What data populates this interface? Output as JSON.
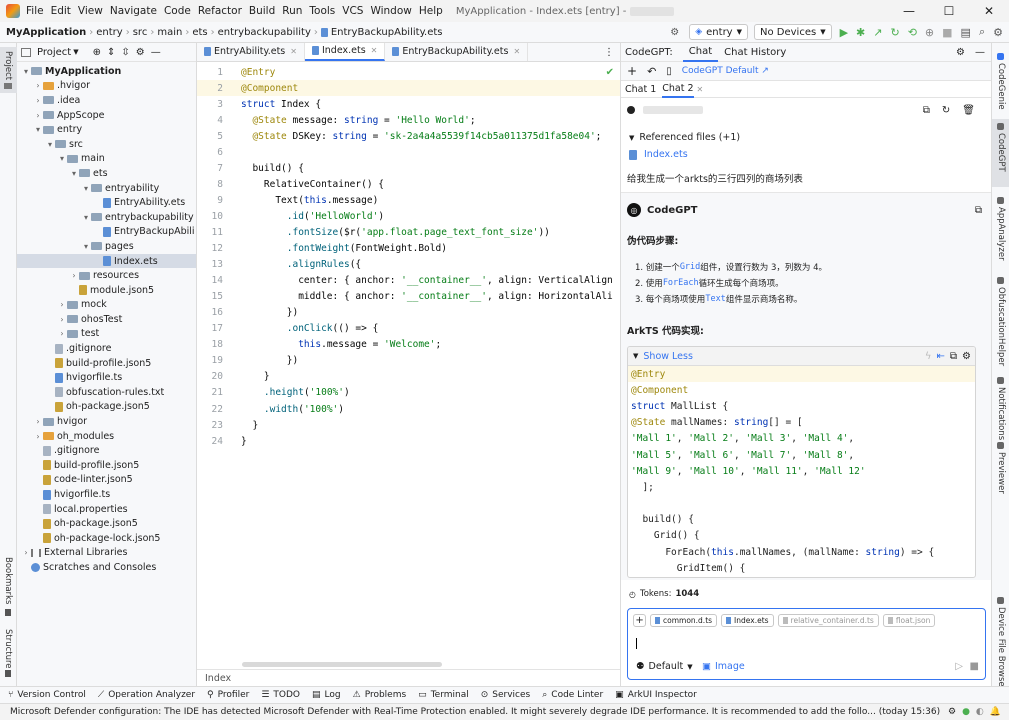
{
  "titlebar": {
    "menu": [
      "File",
      "Edit",
      "View",
      "Navigate",
      "Code",
      "Refactor",
      "Build",
      "Run",
      "Tools",
      "VCS",
      "Window",
      "Help"
    ],
    "title": "MyApplication - Index.ets [entry] -"
  },
  "navbar": {
    "crumbs": [
      "MyApplication",
      "entry",
      "src",
      "main",
      "ets",
      "entrybackupability",
      "EntryBackupAbility.ets"
    ],
    "run_config": "entry",
    "device": "No Devices"
  },
  "left_strip": {
    "project": "Project",
    "bookmarks": "Bookmarks",
    "structure": "Structure"
  },
  "project": {
    "label": "Project",
    "tree": [
      {
        "label": "MyApplication",
        "indent": 0,
        "arrow": "open",
        "icon": "folder"
      },
      {
        "label": ".hvigor",
        "indent": 1,
        "arrow": "closed",
        "icon": "folder-o"
      },
      {
        "label": ".idea",
        "indent": 1,
        "arrow": "closed",
        "icon": "folder"
      },
      {
        "label": "AppScope",
        "indent": 1,
        "arrow": "closed",
        "icon": "folder"
      },
      {
        "label": "entry",
        "indent": 1,
        "arrow": "open",
        "icon": "folder"
      },
      {
        "label": "src",
        "indent": 2,
        "arrow": "open",
        "icon": "folder"
      },
      {
        "label": "main",
        "indent": 3,
        "arrow": "open",
        "icon": "folder"
      },
      {
        "label": "ets",
        "indent": 4,
        "arrow": "open",
        "icon": "folder"
      },
      {
        "label": "entryability",
        "indent": 5,
        "arrow": "open",
        "icon": "folder"
      },
      {
        "label": "EntryAbility.ets",
        "indent": 6,
        "arrow": "",
        "icon": "ts"
      },
      {
        "label": "entrybackupability",
        "indent": 5,
        "arrow": "open",
        "icon": "folder"
      },
      {
        "label": "EntryBackupAbili",
        "indent": 6,
        "arrow": "",
        "icon": "ts"
      },
      {
        "label": "pages",
        "indent": 5,
        "arrow": "open",
        "icon": "folder"
      },
      {
        "label": "Index.ets",
        "indent": 6,
        "arrow": "",
        "icon": "ts",
        "selected": true
      },
      {
        "label": "resources",
        "indent": 4,
        "arrow": "closed",
        "icon": "folder"
      },
      {
        "label": "module.json5",
        "indent": 4,
        "arrow": "",
        "icon": "json"
      },
      {
        "label": "mock",
        "indent": 3,
        "arrow": "closed",
        "icon": "folder"
      },
      {
        "label": "ohosTest",
        "indent": 3,
        "arrow": "closed",
        "icon": "folder"
      },
      {
        "label": "test",
        "indent": 3,
        "arrow": "closed",
        "icon": "folder"
      },
      {
        "label": ".gitignore",
        "indent": 2,
        "arrow": "",
        "icon": "file"
      },
      {
        "label": "build-profile.json5",
        "indent": 2,
        "arrow": "",
        "icon": "json"
      },
      {
        "label": "hvigorfile.ts",
        "indent": 2,
        "arrow": "",
        "icon": "ts"
      },
      {
        "label": "obfuscation-rules.txt",
        "indent": 2,
        "arrow": "",
        "icon": "file"
      },
      {
        "label": "oh-package.json5",
        "indent": 2,
        "arrow": "",
        "icon": "json"
      },
      {
        "label": "hvigor",
        "indent": 1,
        "arrow": "closed",
        "icon": "folder"
      },
      {
        "label": "oh_modules",
        "indent": 1,
        "arrow": "closed",
        "icon": "folder-o"
      },
      {
        "label": ".gitignore",
        "indent": 1,
        "arrow": "",
        "icon": "file"
      },
      {
        "label": "build-profile.json5",
        "indent": 1,
        "arrow": "",
        "icon": "json"
      },
      {
        "label": "code-linter.json5",
        "indent": 1,
        "arrow": "",
        "icon": "json"
      },
      {
        "label": "hvigorfile.ts",
        "indent": 1,
        "arrow": "",
        "icon": "ts"
      },
      {
        "label": "local.properties",
        "indent": 1,
        "arrow": "",
        "icon": "file"
      },
      {
        "label": "oh-package.json5",
        "indent": 1,
        "arrow": "",
        "icon": "json"
      },
      {
        "label": "oh-package-lock.json5",
        "indent": 1,
        "arrow": "",
        "icon": "json"
      },
      {
        "label": "External Libraries",
        "indent": 0,
        "arrow": "closed",
        "icon": "lib"
      },
      {
        "label": "Scratches and Consoles",
        "indent": 0,
        "arrow": "",
        "icon": "scratch"
      }
    ]
  },
  "editor": {
    "tabs": [
      {
        "label": "EntryAbility.ets",
        "active": false
      },
      {
        "label": "Index.ets",
        "active": true
      },
      {
        "label": "EntryBackupAbility.ets",
        "active": false
      }
    ],
    "lines": [
      "@Entry",
      "@Component",
      "struct Index {",
      "  @State message: string = 'Hello World';",
      "  @State DSKey: string = 'sk-2a4a4a5539f14cb5a011375d1fa58e04';",
      "",
      "  build() {",
      "    RelativeContainer() {",
      "      Text(this.message)",
      "        .id('HelloWorld')",
      "        .fontSize($r('app.float.page_text_font_size'))",
      "        .fontWeight(FontWeight.Bold)",
      "        .alignRules({",
      "          center: { anchor: '__container__', align: VerticalAlign",
      "          middle: { anchor: '__container__', align: HorizontalAli",
      "        })",
      "        .onClick(() => {",
      "          this.message = 'Welcome';",
      "        })",
      "    }",
      "    .height('100%')",
      "    .width('100%')",
      "  }",
      "}"
    ],
    "breadcrumb": "Index"
  },
  "codegpt": {
    "title": "CodeGPT:",
    "tab_chat": "Chat",
    "tab_history": "Chat History",
    "default_link": "CodeGPT Default ↗",
    "chat_tabs": [
      "Chat 1",
      "Chat 2"
    ],
    "referenced": "Referenced files (+1)",
    "ref_file": "Index.ets",
    "user_prompt": "给我生成一个arkts的三行四列的商场列表",
    "bot_name": "CodeGPT",
    "pseudo_heading": "伪代码步骤:",
    "steps": [
      {
        "pre": "1. 创建一个 ",
        "code": "Grid",
        "post": " 组件，设置行数为 3，列数为 4。"
      },
      {
        "pre": "2. 使用 ",
        "code": "ForEach",
        "post": " 循环生成每个商场项。"
      },
      {
        "pre": "3. 每个商场项使用 ",
        "code": "Text",
        "post": " 组件显示商场名称。"
      }
    ],
    "impl_heading": "ArkTS 代码实现:",
    "show_less": "Show Less",
    "code_lines": [
      "@Entry",
      "@Component",
      "struct MallList {",
      "  @State mallNames: string[] = [",
      "    'Mall 1', 'Mall 2', 'Mall 3', 'Mall 4',",
      "    'Mall 5', 'Mall 6', 'Mall 7', 'Mall 8',",
      "    'Mall 9', 'Mall 10', 'Mall 11', 'Mall 12'",
      "  ];",
      "",
      "  build() {",
      "    Grid() {",
      "      ForEach(this.mallNames, (mallName: string) => {",
      "        GridItem() {"
    ],
    "tokens_label": "Tokens:",
    "tokens_value": "1044",
    "chips": [
      "common.d.ts",
      "Index.ets",
      "relative_container.d.ts",
      "float.json"
    ],
    "model": "Default",
    "image_label": "Image"
  },
  "right_strip": [
    "CodeGenie",
    "CodeGPT",
    "AppAnalyzer",
    "ObfuscationHelper",
    "Notifications",
    "Previewer",
    "Device File Browser"
  ],
  "bottombar": [
    "Version Control",
    "Operation Analyzer",
    "Profiler",
    "TODO",
    "Log",
    "Problems",
    "Terminal",
    "Services",
    "Code Linter",
    "ArkUI Inspector"
  ],
  "status": {
    "message": "Microsoft Defender configuration: The IDE has detected Microsoft Defender with Real-Time Protection enabled. It might severely degrade IDE performance. It is recommended to add the follo... (today 15:36)"
  }
}
